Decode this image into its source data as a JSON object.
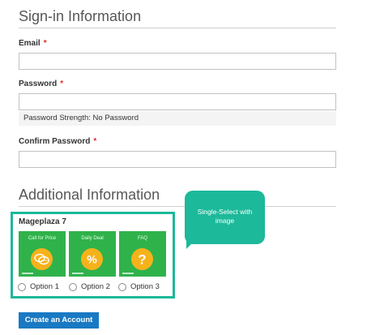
{
  "signin": {
    "title": "Sign-in Information",
    "email_label": "Email",
    "password_label": "Password",
    "password_strength": "Password Strength: No Password",
    "confirm_password_label": "Confirm Password",
    "required_mark": "*",
    "email_value": "",
    "password_value": "",
    "confirm_password_value": ""
  },
  "additional": {
    "title": "Additional Information",
    "group_label": "Mageplaza 7",
    "options": [
      {
        "label": "Option 1",
        "image_caption": "Call for Price",
        "image_glyph": "💬",
        "icon": "chat-bubbles-icon",
        "selected": false
      },
      {
        "label": "Option 2",
        "image_caption": "Daily Deal",
        "image_glyph": "%",
        "icon": "percent-icon",
        "selected": false
      },
      {
        "label": "Option 3",
        "image_caption": "FAQ",
        "image_glyph": "?",
        "icon": "question-icon",
        "selected": false
      }
    ]
  },
  "tooltip": {
    "line1": "Single-Select with",
    "line2": "image"
  },
  "actions": {
    "create_label": "Create an Account"
  },
  "colors": {
    "accent_teal": "#1cb99a",
    "image_green": "#30b24b",
    "image_circle": "#f6b21b",
    "button_blue": "#1979c3",
    "required_red": "#e02b27"
  }
}
